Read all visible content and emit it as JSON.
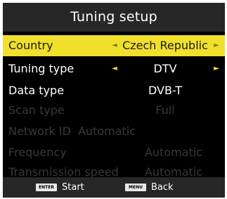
{
  "title": "Tuning setup",
  "rows": {
    "country": {
      "label": "Country",
      "value": "Czech Republic"
    },
    "tuning_type": {
      "label": "Tuning type",
      "value": "DTV"
    },
    "data_type": {
      "label": "Data type",
      "value": "DVB-T"
    },
    "scan_type": {
      "label": "Scan type",
      "value": "Full"
    },
    "network_id": {
      "label": "Network ID",
      "value": "Automatic"
    },
    "frequency": {
      "label": "Frequency",
      "value": "Automatic"
    },
    "transmission_speed": {
      "label": "Transmission speed",
      "value": "Automatic"
    }
  },
  "footer": {
    "enter_key": "ENTER",
    "start_label": "Start",
    "menu_key": "MENU",
    "back_label": "Back"
  },
  "colors": {
    "highlight": "#f0e02c",
    "background": "#000000",
    "bar": "#272727",
    "disabled_text": "#383838"
  },
  "icons": {
    "left_arrow": "◄",
    "right_arrow": "►"
  }
}
